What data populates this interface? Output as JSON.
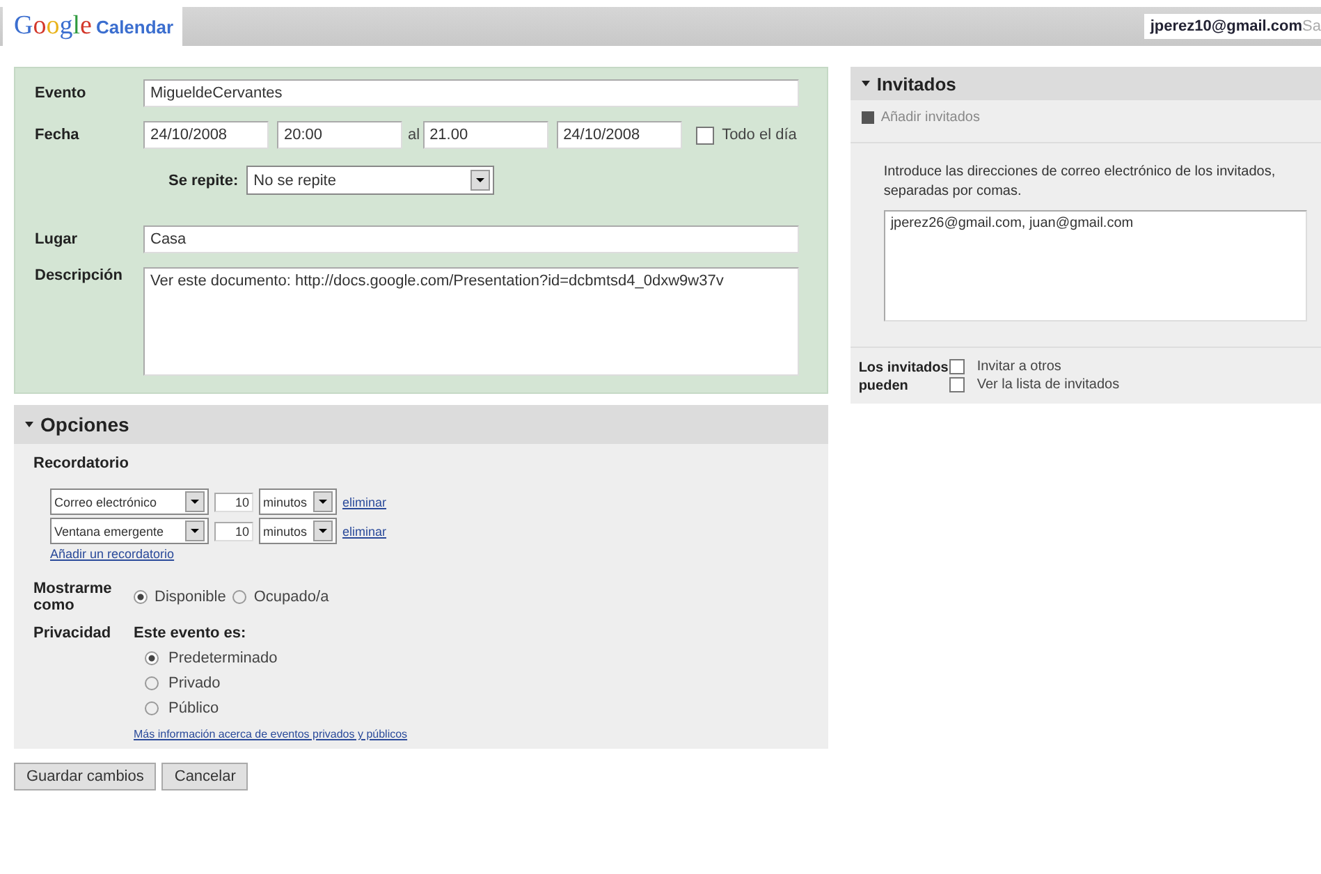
{
  "header": {
    "logo_google": "Google",
    "logo_product": "Calendar",
    "user": "jperez10@gmail.com",
    "link": "Sa"
  },
  "event": {
    "title_label": "Evento",
    "title": "MigueldeCervantes",
    "date_label": "Fecha",
    "start_date": "24/10/2008",
    "start_time": "20:00",
    "to": "al",
    "end_time": "21.00",
    "end_date": "24/10/2008",
    "all_day": {
      "label": "Todo el día",
      "checked": false
    },
    "repeat_label": "Se repite:",
    "repeat": "No se repite",
    "place_label": "Lugar",
    "place": "Casa",
    "description_label": "Descripción",
    "description": "Ver este documento: http://docs.google.com/Presentation?id=dcbmtsd4_0dxw9w37v"
  },
  "options": {
    "title": "Opciones",
    "reminder_label": "Recordatorio",
    "reminders": [
      {
        "method": "Correo electrónico",
        "amount": "10",
        "unit": "minutos",
        "remove": "eliminar"
      },
      {
        "method": "Ventana emergente",
        "amount": "10",
        "unit": "minutos",
        "remove": "eliminar"
      }
    ],
    "add_reminder": "Añadir un recordatorio",
    "show_me_label": "Mostrarme como",
    "show_me": [
      {
        "label": "Disponible",
        "selected": true
      },
      {
        "label": "Ocupado/a",
        "selected": false
      }
    ],
    "privacy_label": "Privacidad",
    "privacy_heading": "Este evento es:",
    "privacy": [
      {
        "label": "Predeterminado",
        "selected": true
      },
      {
        "label": "Privado",
        "selected": false
      },
      {
        "label": "Público",
        "selected": false
      }
    ],
    "privacy_link": "Más información acerca de eventos privados y públicos"
  },
  "buttons": [
    "Guardar cambios",
    "Cancelar"
  ],
  "guests": {
    "title": "Invitados",
    "add": "Añadir invitados",
    "hint": "Introduce las direcciones de correo electrónico de los invitados, separadas por comas.",
    "emails": "jperez26@gmail.com, juan@gmail.com",
    "can_label": "Los invitados pueden",
    "permissions": [
      {
        "label": "Invitar a otros",
        "checked": false
      },
      {
        "label": "Ver la lista de invitados",
        "checked": false
      }
    ]
  }
}
